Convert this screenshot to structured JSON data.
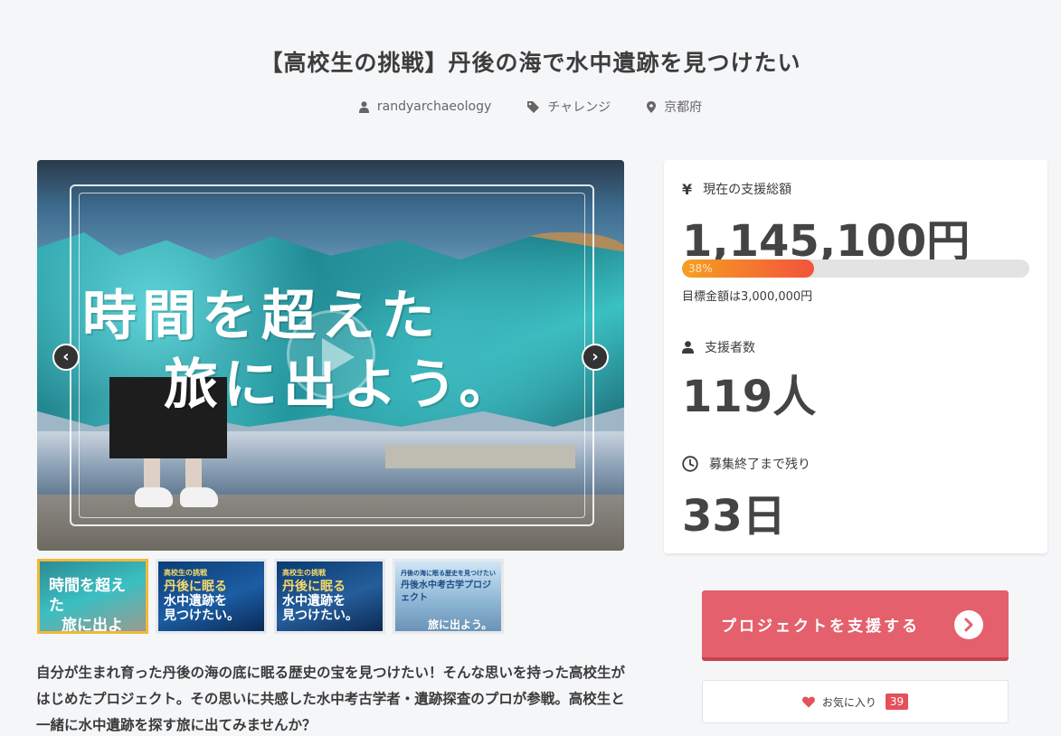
{
  "project": {
    "title": "【高校生の挑戦】丹後の海で水中遺跡を見つけたい",
    "owner": "randyarchaeology",
    "category": "チャレンジ",
    "location": "京都府"
  },
  "hero": {
    "catch_line1": "時間を超えた",
    "catch_line2": "旅に出よう。",
    "prev_label": "‹",
    "next_label": "›"
  },
  "thumbnails": [
    {
      "small": "",
      "big1": "時間を超えた",
      "big2": "旅に出よう。"
    },
    {
      "small": "高校生の挑戦",
      "big1": "丹後に眠る",
      "big2": "水中遺跡を",
      "big3": "見つけたい。"
    },
    {
      "small": "高校生の挑戦",
      "big1": "丹後に眠る",
      "big2": "水中遺跡を",
      "big3": "見つけたい。"
    },
    {
      "small": "丹後の海に眠る歴史を見つけたい",
      "big1": "丹後水中考古学プロジェクト",
      "big2": "旅に出よう。"
    }
  ],
  "description": "自分が生まれ育った丹後の海の底に眠る歴史の宝を見つけたい！そんな思いを持った高校生がはじめたプロジェクト。その思いに共感した水中考古学者・遺跡探査のプロが参戦。高校生と一緒に水中遺跡を探す旅に出てみませんか？",
  "stats": {
    "total_label": "現在の支援総額",
    "total_value": "1,145,100円",
    "progress_label": "38%",
    "progress_percent": 38,
    "goal_text": "目標金額は3,000,000円",
    "backers_label": "支援者数",
    "backers_value": "119人",
    "remaining_label": "募集終了まで残り",
    "remaining_value": "33日"
  },
  "actions": {
    "support_label": "プロジェクトを支援する",
    "favorite_label": "お気に入り",
    "favorite_count": "39"
  },
  "icons": {
    "user": "user-icon",
    "tag": "tag-icon",
    "location": "map-pin-icon",
    "yen": "yen-icon",
    "clock": "clock-icon",
    "heart": "heart-icon",
    "chevron": "chevron-right-icon"
  },
  "colors": {
    "accent": "#e4606c",
    "progress_start": "#f5a020",
    "progress_end": "#f3533d",
    "heart": "#e4505b",
    "thumb_active": "#f2b83a"
  }
}
